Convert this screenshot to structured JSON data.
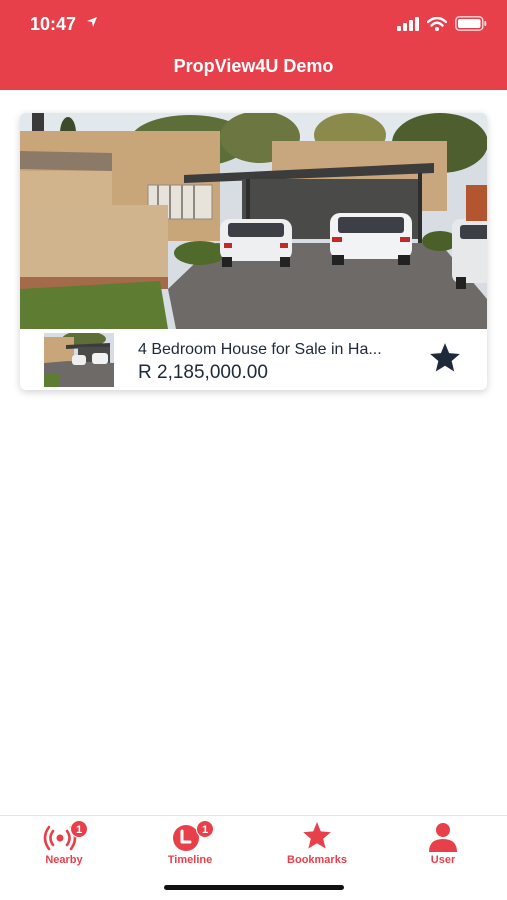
{
  "status_bar": {
    "time": "10:47"
  },
  "header": {
    "title": "PropView4U Demo"
  },
  "listing": {
    "title": "4 Bedroom House for Sale in Ha...",
    "price": "R 2,185,000.00",
    "bookmarked": true
  },
  "tabs": [
    {
      "label": "Nearby",
      "icon": "nearby-icon",
      "badge": "1"
    },
    {
      "label": "Timeline",
      "icon": "timeline-icon",
      "badge": "1"
    },
    {
      "label": "Bookmarks",
      "icon": "star-icon"
    },
    {
      "label": "User",
      "icon": "user-icon"
    }
  ],
  "colors": {
    "accent": "#E8404A",
    "text": "#1E2A3A",
    "star": "#1E2A3A"
  }
}
